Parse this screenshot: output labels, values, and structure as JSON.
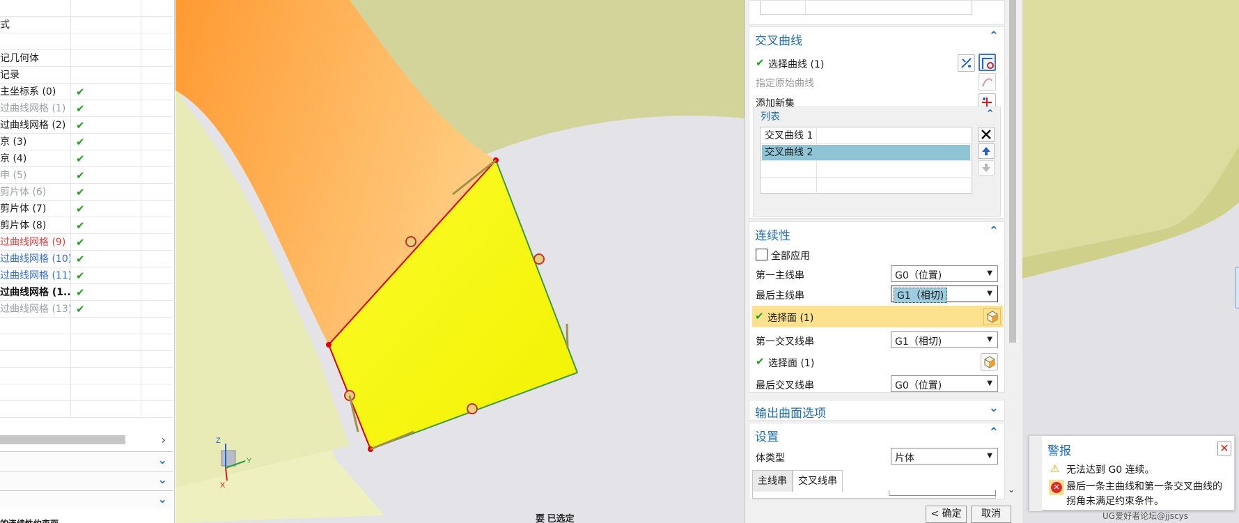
{
  "navigator": {
    "rows": [
      {
        "label": "",
        "status": "",
        "checked": false
      },
      {
        "label": "式",
        "status": "",
        "checked": false
      },
      {
        "label": "",
        "status": "",
        "checked": false
      },
      {
        "label": "记几何体",
        "status": "",
        "checked": false
      },
      {
        "label": "记录",
        "status": "",
        "checked": false
      },
      {
        "label": "主坐标系 (0)",
        "status": "normal",
        "checked": true
      },
      {
        "label": "过曲线网格 (1)",
        "status": "grey",
        "checked": true
      },
      {
        "label": "过曲线网格 (2)",
        "status": "normal",
        "checked": true
      },
      {
        "label": "京 (3)",
        "status": "normal",
        "checked": true
      },
      {
        "label": "京 (4)",
        "status": "normal",
        "checked": true
      },
      {
        "label": "申 (5)",
        "status": "grey",
        "checked": true
      },
      {
        "label": "剪片体 (6)",
        "status": "grey",
        "checked": true
      },
      {
        "label": "剪片体 (7)",
        "status": "normal",
        "checked": true
      },
      {
        "label": "剪片体 (8)",
        "status": "normal",
        "checked": true
      },
      {
        "label": "过曲线网格 (9)",
        "status": "red",
        "checked": true
      },
      {
        "label": "过曲线网格 (10)",
        "status": "blue",
        "checked": true
      },
      {
        "label": "过曲线网格 (11)",
        "status": "blue",
        "checked": true
      },
      {
        "label": "过曲线网格 (1...",
        "status": "bold",
        "checked": true
      },
      {
        "label": "过曲线网格 (13)",
        "status": "grey",
        "checked": true
      },
      {
        "label": "",
        "status": "",
        "checked": false
      },
      {
        "label": "",
        "status": "",
        "checked": false
      },
      {
        "label": "",
        "status": "",
        "checked": false
      },
      {
        "label": "",
        "status": "",
        "checked": false
      },
      {
        "label": "",
        "status": "",
        "checked": false
      },
      {
        "label": "",
        "status": "",
        "checked": false
      }
    ],
    "scroll_right": "›",
    "footer_left": "的连续性约束面",
    "footer_mid": "耍 已选定"
  },
  "dialog": {
    "cross_curve": {
      "title": "交叉曲线",
      "select_curve": "选择曲线 (1)",
      "specify_original": "指定原始曲线",
      "add_new_set": "添加新集",
      "list_title": "列表",
      "list_items": [
        "交叉曲线 1",
        "交叉曲线 2"
      ]
    },
    "continuity": {
      "title": "连续性",
      "apply_all": "全部应用",
      "first_primary_label": "第一主线串",
      "first_primary_value": "G0（位置)",
      "last_primary_label": "最后主线串",
      "last_primary_value": "G1（相切)",
      "select_face_1": "选择面 (1)",
      "first_cross_label": "第一交叉线串",
      "first_cross_value": "G1（相切)",
      "select_face_2": "选择面 (1)",
      "last_cross_label": "最后交叉线串",
      "last_cross_value": "G0（位置)"
    },
    "output_options": {
      "title": "输出曲面选项"
    },
    "settings": {
      "title": "设置",
      "body_type_label": "体类型",
      "body_type_value": "片体",
      "tab_primary": "主线串",
      "tab_cross": "交叉线串"
    },
    "ok_button": "< 确定 >",
    "cancel_button": "取消"
  },
  "alert": {
    "title": "警报",
    "warning": "无法达到 G0 连续。",
    "error": "最后一条主曲线和第一条交叉曲线的拐角未满足约束条件。",
    "close": "✕"
  },
  "viewport": {
    "axis_x": "X",
    "axis_y": "Y",
    "axis_z": "Z"
  },
  "watermark": "UG爱好者论坛@jjscys",
  "colors": {
    "accent": "#1f6fb2",
    "check": "#1ca51c",
    "highlight": "#fce28e",
    "selected_item": "#8fc4d6",
    "surface_yellow": "#ffff00",
    "surface_orange": "#ffb14e"
  }
}
